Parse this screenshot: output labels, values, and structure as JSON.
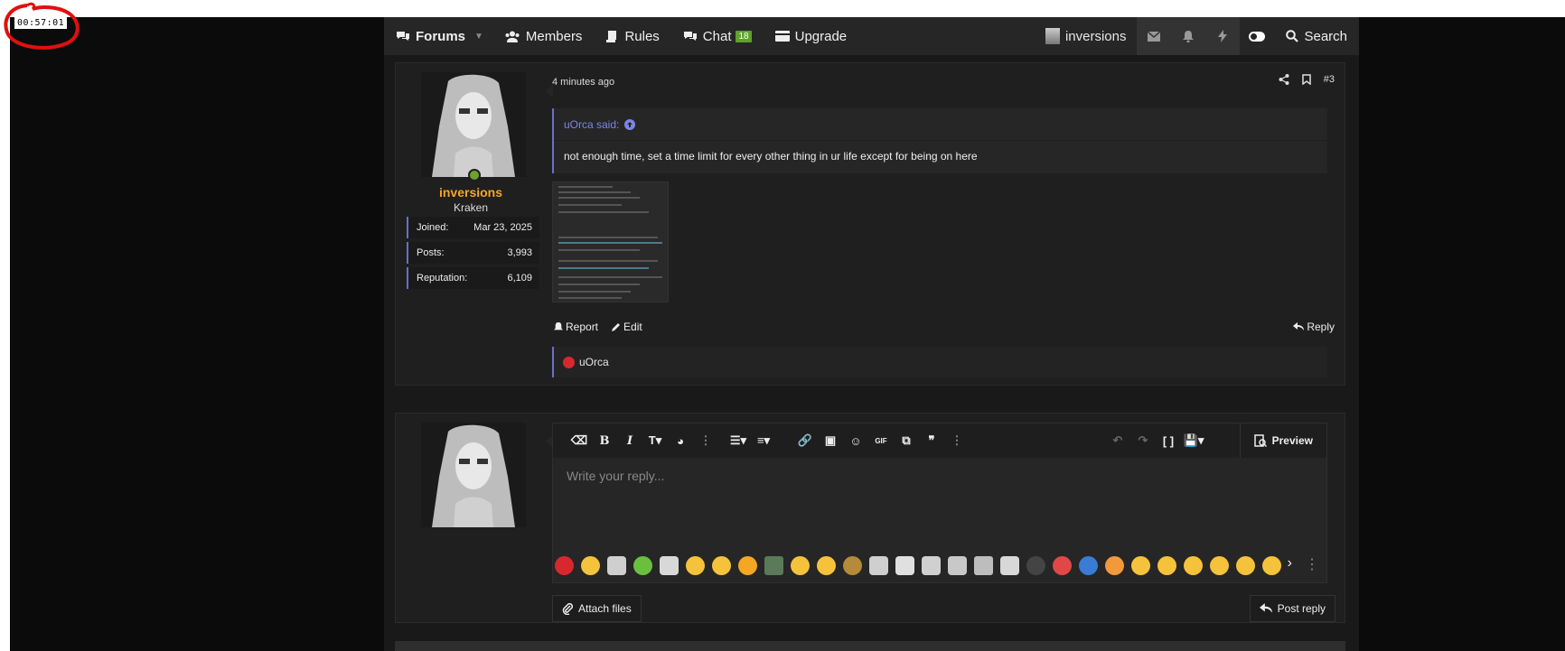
{
  "timer": "00:57:01",
  "nav": {
    "forums": "Forums",
    "members": "Members",
    "rules": "Rules",
    "chat": "Chat",
    "chat_badge": "18",
    "upgrade": "Upgrade",
    "user": "inversions",
    "search": "Search"
  },
  "post": {
    "username": "inversions",
    "user_title": "Kraken",
    "stats": [
      {
        "label": "Joined:",
        "value": "Mar 23, 2025"
      },
      {
        "label": "Posts:",
        "value": "3,993"
      },
      {
        "label": "Reputation:",
        "value": "6,109"
      }
    ],
    "time": "4 minutes ago",
    "number": "#3",
    "quote_author": "uOrca said:",
    "quote_text": "not enough time, set a time limit for every other thing in ur life except for being on here",
    "report": "Report",
    "edit": "Edit",
    "reply": "Reply",
    "reaction_user": "uOrca"
  },
  "editor": {
    "placeholder": "Write your reply...",
    "preview": "Preview",
    "attach": "Attach files",
    "post_reply": "Post reply"
  },
  "colors": {
    "accent": "#6871c8",
    "username": "#f5a623",
    "online": "#6da22f",
    "chat_badge": "#5fa22a"
  }
}
